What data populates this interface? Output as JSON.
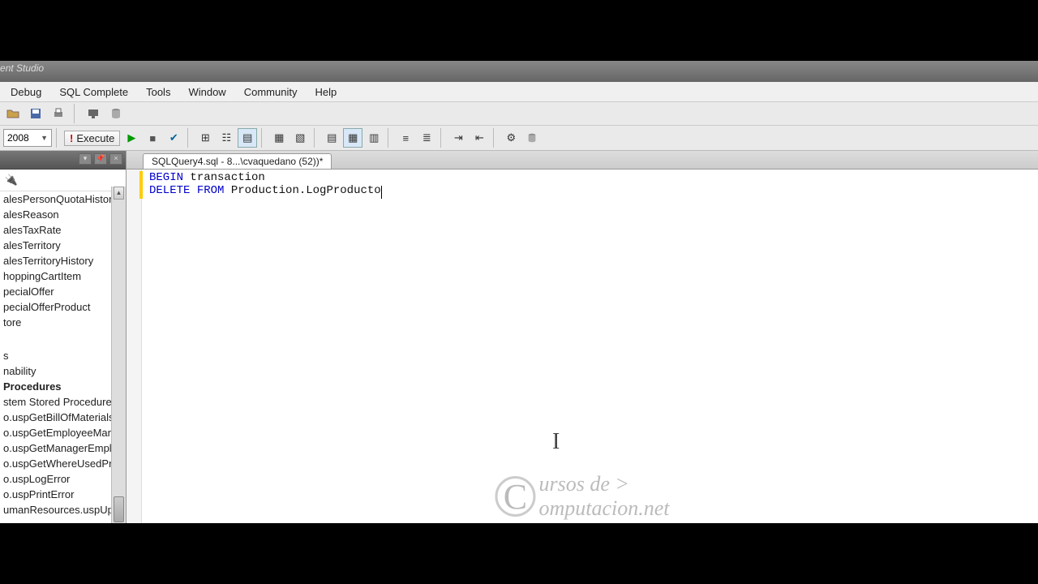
{
  "title_fragment": "agement Studio",
  "menu": {
    "debug": "Debug",
    "sqlcomplete": "SQL Complete",
    "tools": "Tools",
    "window": "Window",
    "community": "Community",
    "help": "Help"
  },
  "toolbar": {
    "db_version": "2008",
    "execute": "Execute"
  },
  "tab": {
    "label": "SQLQuery4.sql - 8...\\cvaquedano (52))*"
  },
  "code": {
    "line1_kw1": "BEGIN",
    "line1_rest": " transaction",
    "line2_kw1": "DELETE",
    "line2_kw2": "FROM",
    "line2_ident": " Production.LogProducto"
  },
  "tree": {
    "items": [
      "alesPersonQuotaHistor",
      "alesReason",
      "alesTaxRate",
      "alesTerritory",
      "alesTerritoryHistory",
      "hoppingCartItem",
      "pecialOffer",
      "pecialOfferProduct",
      "tore"
    ],
    "items2": [
      "s",
      "nability",
      "Procedures",
      "stem Stored Procedures",
      "o.uspGetBillOfMaterials",
      "o.uspGetEmployeeMan",
      "o.uspGetManagerEmplo",
      "o.uspGetWhereUsedPro",
      "o.uspLogError",
      "o.uspPrintError",
      "umanResources.uspUpd"
    ]
  },
  "watermark": {
    "line1": "ursos de >",
    "line2": "omputacion.net"
  }
}
